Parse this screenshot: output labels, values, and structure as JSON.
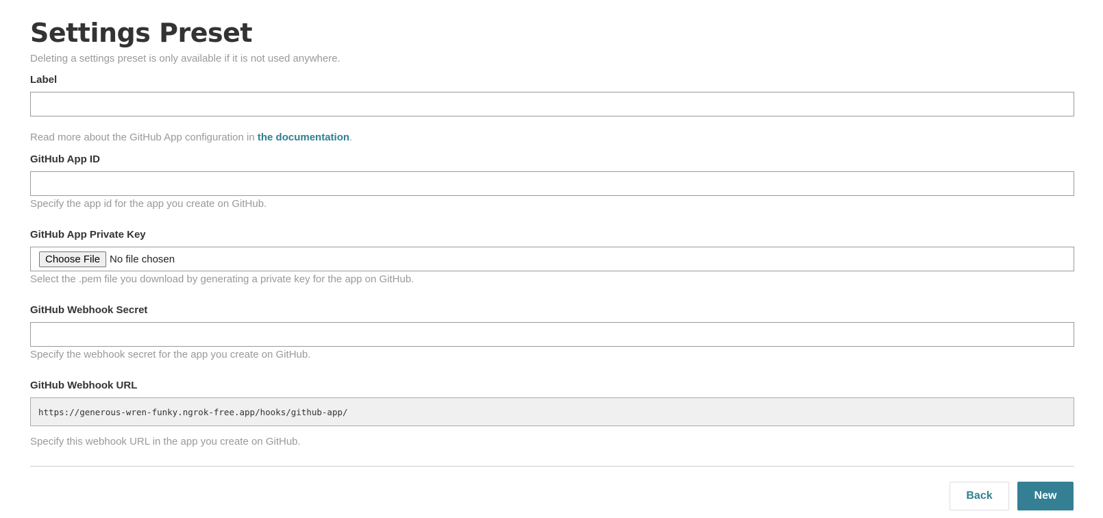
{
  "page": {
    "title": "Settings Preset",
    "subtitle": "Deleting a settings preset is only available if it is not used anywhere."
  },
  "form": {
    "label": {
      "label": "Label",
      "value": ""
    },
    "docs_note": {
      "prefix": "Read more about the GitHub App configuration in ",
      "link_text": "the documentation",
      "suffix": "."
    },
    "app_id": {
      "label": "GitHub App ID",
      "value": "",
      "help": "Specify the app id for the app you create on GitHub."
    },
    "private_key": {
      "label": "GitHub App Private Key",
      "button_label": "Choose File",
      "status": "No file chosen",
      "help": "Select the .pem file you download by generating a private key for the app on GitHub."
    },
    "webhook_secret": {
      "label": "GitHub Webhook Secret",
      "value": "",
      "help": "Specify the webhook secret for the app you create on GitHub."
    },
    "webhook_url": {
      "label": "GitHub Webhook URL",
      "value": "https://generous-wren-funky.ngrok-free.app/hooks/github-app/",
      "help": "Specify this webhook URL in the app you create on GitHub."
    }
  },
  "actions": {
    "back_label": "Back",
    "new_label": "New"
  },
  "colors": {
    "accent": "#347f93",
    "link": "#2e8090",
    "help_text": "#999999"
  }
}
